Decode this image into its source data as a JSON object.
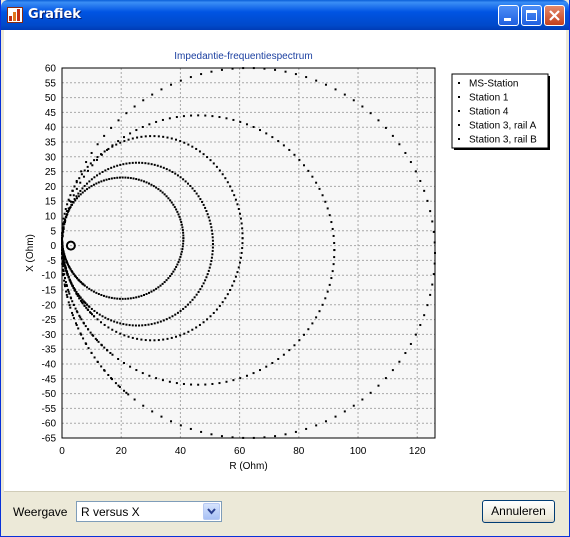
{
  "window": {
    "title": "Grafiek",
    "icons": {
      "app": "chart-app-icon",
      "minimize": "minimize-icon",
      "maximize": "maximize-icon",
      "close": "close-icon"
    }
  },
  "controls": {
    "view_label": "Weergave",
    "view_value": "R versus X",
    "cancel_label": "Annuleren"
  },
  "chart_data": {
    "type": "scatter",
    "title": "Impedantie-frequentiespectrum",
    "xlabel": "R (Ohm)",
    "ylabel": "X (Ohm)",
    "xlim": [
      0,
      126
    ],
    "ylim": [
      -65,
      60
    ],
    "xticks": [
      0,
      20,
      40,
      60,
      80,
      100,
      120
    ],
    "yticks": [
      60,
      55,
      50,
      45,
      40,
      35,
      30,
      25,
      20,
      15,
      10,
      5,
      0,
      -5,
      -10,
      -15,
      -20,
      -25,
      -30,
      -35,
      -40,
      -45,
      -50,
      -55,
      -60,
      -65
    ],
    "grid": true,
    "legend_position": "top-right",
    "series": [
      {
        "name": "MS-Station",
        "loop_r_max": 126,
        "loop_x_max": 60,
        "loop_x_min": -65
      },
      {
        "name": "Station 1",
        "loop_r_max": 92,
        "loop_x_max": 44,
        "loop_x_min": -47
      },
      {
        "name": "Station 4",
        "loop_r_max": 61,
        "loop_x_max": 37,
        "loop_x_min": -32
      },
      {
        "name": "Station 3, rail A",
        "loop_r_max": 41,
        "loop_x_max": 23,
        "loop_x_min": -18
      },
      {
        "name": "Station 3, rail B",
        "loop_r_max": 51,
        "loop_x_max": 28,
        "loop_x_min": -27
      }
    ]
  }
}
